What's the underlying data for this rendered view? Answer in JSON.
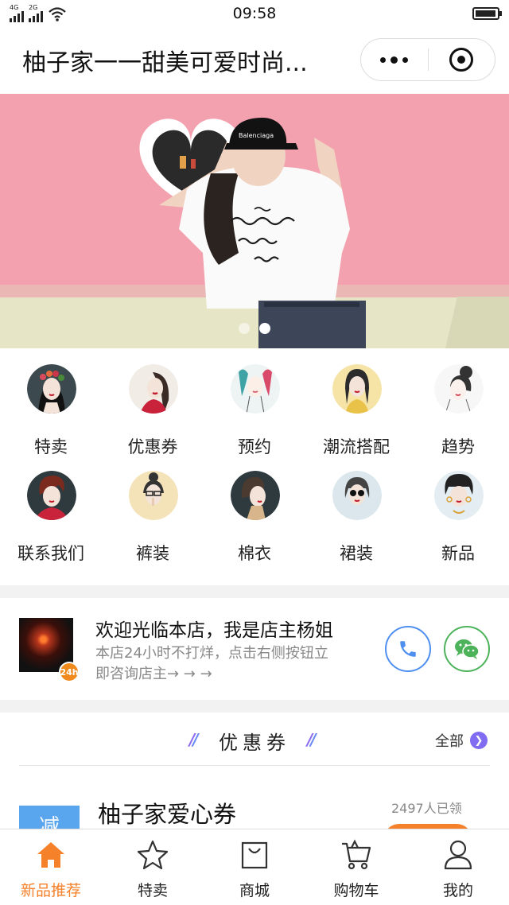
{
  "status_bar": {
    "network_1": "4G",
    "network_2": "2G",
    "time": "09:58",
    "battery_level": 0.95
  },
  "nav": {
    "title": "柚子家一一甜美可爱时尚...",
    "more_icon": "more-dots-icon",
    "close_icon": "target-close-icon"
  },
  "banner": {
    "page_count": 2,
    "active_page": 2
  },
  "categories": [
    {
      "label": "特卖",
      "icon": "woman-flower-crown-icon"
    },
    {
      "label": "优惠券",
      "icon": "woman-red-lips-icon"
    },
    {
      "label": "预约",
      "icon": "woman-teal-hair-icon"
    },
    {
      "label": "潮流搭配",
      "icon": "woman-yellow-sweater-icon"
    },
    {
      "label": "趋势",
      "icon": "woman-bun-sketch-icon"
    },
    {
      "label": "联系我们",
      "icon": "woman-short-hair-icon"
    },
    {
      "label": "裤装",
      "icon": "woman-hush-icon"
    },
    {
      "label": "棉衣",
      "icon": "woman-profile-icon"
    },
    {
      "label": "裙装",
      "icon": "woman-sunglasses-icon"
    },
    {
      "label": "新品",
      "icon": "woman-pompadour-icon"
    }
  ],
  "owner": {
    "title": "欢迎光临本店，我是店主杨姐",
    "subtitle": "本店24小时不打烊，点击右侧按钮立即咨询店主→ → →",
    "badge": "24h",
    "phone_icon": "phone-icon",
    "wechat_icon": "wechat-icon"
  },
  "coupons": {
    "section_title": "优惠券",
    "all_label": "全部",
    "items": [
      {
        "badge": "减",
        "name": "柚子家爱心券",
        "claimed": "2497人已领"
      }
    ]
  },
  "tabbar": [
    {
      "label": "新品推荐",
      "icon": "home-icon",
      "active": true
    },
    {
      "label": "特卖",
      "icon": "star-icon",
      "active": false
    },
    {
      "label": "商城",
      "icon": "shopping-bag-icon",
      "active": false
    },
    {
      "label": "购物车",
      "icon": "cart-icon",
      "active": false
    },
    {
      "label": "我的",
      "icon": "user-icon",
      "active": false
    }
  ],
  "colors": {
    "accent": "#f5812b",
    "phone": "#4e8ff0",
    "wechat": "#4cb35a",
    "coupon_badge": "#5aa6ee",
    "banner_bg": "#f3a0ad"
  }
}
